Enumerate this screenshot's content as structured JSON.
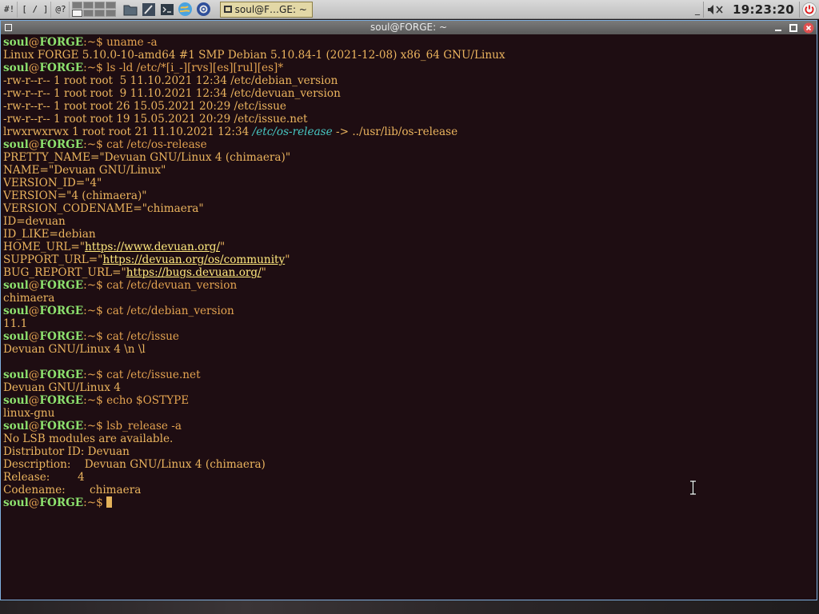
{
  "panel": {
    "btn_hash": "#!",
    "btn_brackets": "[ / ]",
    "btn_at": "@?",
    "task_label": "soul@F…GE: ~",
    "clock": "19:23:20"
  },
  "window": {
    "title": "soul@FORGE: ~"
  },
  "terminal": {
    "user": "soul",
    "at": "@",
    "host": "FORGE",
    "prompt_suffix": ":~$ ",
    "lines": [
      {
        "type": "cmd",
        "text": "uname -a"
      },
      {
        "type": "out",
        "text": "Linux FORGE 5.10.0-10-amd64 #1 SMP Debian 5.10.84-1 (2021-12-08) x86_64 GNU/Linux"
      },
      {
        "type": "cmd",
        "text": "ls -ld /etc/*[i_-][rvs][es][rul][es]*"
      },
      {
        "type": "out",
        "text": "-rw-r--r-- 1 root root  5 11.10.2021 12:34 /etc/debian_version"
      },
      {
        "type": "out",
        "text": "-rw-r--r-- 1 root root  9 11.10.2021 12:34 /etc/devuan_version"
      },
      {
        "type": "out",
        "text": "-rw-r--r-- 1 root root 26 15.05.2021 20:29 /etc/issue"
      },
      {
        "type": "out",
        "text": "-rw-r--r-- 1 root root 19 15.05.2021 20:29 /etc/issue.net"
      },
      {
        "type": "symlink",
        "pre": "lrwxrwxrwx 1 root root 21 11.10.2021 12:34 ",
        "link": "/etc/os-release",
        "post": " -> ../usr/lib/os-release"
      },
      {
        "type": "cmd",
        "text": "cat /etc/os-release"
      },
      {
        "type": "out",
        "text": "PRETTY_NAME=\"Devuan GNU/Linux 4 (chimaera)\""
      },
      {
        "type": "out",
        "text": "NAME=\"Devuan GNU/Linux\""
      },
      {
        "type": "out",
        "text": "VERSION_ID=\"4\""
      },
      {
        "type": "out",
        "text": "VERSION=\"4 (chimaera)\""
      },
      {
        "type": "out",
        "text": "VERSION_CODENAME=\"chimaera\""
      },
      {
        "type": "out",
        "text": "ID=devuan"
      },
      {
        "type": "out",
        "text": "ID_LIKE=debian"
      },
      {
        "type": "url",
        "pre": "HOME_URL=\"",
        "url": "https://www.devuan.org/",
        "post": "\""
      },
      {
        "type": "url",
        "pre": "SUPPORT_URL=\"",
        "url": "https://devuan.org/os/community",
        "post": "\""
      },
      {
        "type": "url",
        "pre": "BUG_REPORT_URL=\"",
        "url": "https://bugs.devuan.org/",
        "post": "\""
      },
      {
        "type": "cmd",
        "text": "cat /etc/devuan_version"
      },
      {
        "type": "out",
        "text": "chimaera"
      },
      {
        "type": "cmd",
        "text": "cat /etc/debian_version"
      },
      {
        "type": "out",
        "text": "11.1"
      },
      {
        "type": "cmd",
        "text": "cat /etc/issue"
      },
      {
        "type": "out",
        "text": "Devuan GNU/Linux 4 \\n \\l"
      },
      {
        "type": "out",
        "text": ""
      },
      {
        "type": "cmd",
        "text": "cat /etc/issue.net"
      },
      {
        "type": "out",
        "text": "Devuan GNU/Linux 4"
      },
      {
        "type": "cmd",
        "text": "echo $OSTYPE"
      },
      {
        "type": "out",
        "text": "linux-gnu"
      },
      {
        "type": "cmd",
        "text": "lsb_release -a"
      },
      {
        "type": "out",
        "text": "No LSB modules are available."
      },
      {
        "type": "out",
        "text": "Distributor ID: Devuan"
      },
      {
        "type": "out",
        "text": "Description:    Devuan GNU/Linux 4 (chimaera)"
      },
      {
        "type": "out",
        "text": "Release:        4"
      },
      {
        "type": "out",
        "text": "Codename:       chimaera"
      },
      {
        "type": "prompt",
        "text": ""
      }
    ]
  }
}
